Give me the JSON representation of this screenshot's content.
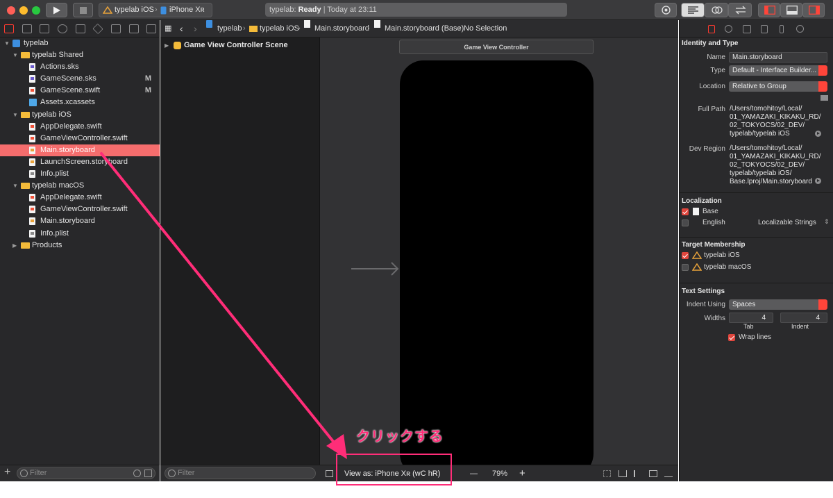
{
  "toolbar": {
    "scheme_target": "typelab iOS",
    "scheme_device": "iPhone Xʀ",
    "status_project": "typelab:",
    "status_state": "Ready",
    "status_time": "Today at 23:11"
  },
  "navigator": {
    "items": [
      {
        "label": "typelab",
        "level": 0,
        "kind": "project",
        "expanded": true,
        "badge": ""
      },
      {
        "label": "typelab Shared",
        "level": 1,
        "kind": "folder",
        "expanded": true,
        "badge": ""
      },
      {
        "label": "Actions.sks",
        "level": 2,
        "kind": "sks",
        "badge": ""
      },
      {
        "label": "GameScene.sks",
        "level": 2,
        "kind": "sks",
        "badge": "M"
      },
      {
        "label": "GameScene.swift",
        "level": 2,
        "kind": "swift",
        "badge": "M"
      },
      {
        "label": "Assets.xcassets",
        "level": 2,
        "kind": "assets",
        "badge": ""
      },
      {
        "label": "typelab iOS",
        "level": 1,
        "kind": "folder",
        "expanded": true,
        "badge": ""
      },
      {
        "label": "AppDelegate.swift",
        "level": 2,
        "kind": "swift",
        "badge": ""
      },
      {
        "label": "GameViewController.swift",
        "level": 2,
        "kind": "swift",
        "badge": ""
      },
      {
        "label": "Main.storyboard",
        "level": 2,
        "kind": "sb",
        "badge": "",
        "selected": true
      },
      {
        "label": "LaunchScreen.storyboard",
        "level": 2,
        "kind": "sb",
        "badge": ""
      },
      {
        "label": "Info.plist",
        "level": 2,
        "kind": "plist",
        "badge": ""
      },
      {
        "label": "typelab macOS",
        "level": 1,
        "kind": "folder",
        "expanded": true,
        "badge": ""
      },
      {
        "label": "AppDelegate.swift",
        "level": 2,
        "kind": "swift",
        "badge": ""
      },
      {
        "label": "GameViewController.swift",
        "level": 2,
        "kind": "swift",
        "badge": ""
      },
      {
        "label": "Main.storyboard",
        "level": 2,
        "kind": "sb",
        "badge": ""
      },
      {
        "label": "Info.plist",
        "level": 2,
        "kind": "plist",
        "badge": ""
      },
      {
        "label": "Products",
        "level": 1,
        "kind": "folder",
        "expanded": false,
        "badge": ""
      }
    ],
    "filter_placeholder": "Filter"
  },
  "jumpbar": {
    "crumbs": [
      "typelab",
      "typelab iOS",
      "Main.storyboard",
      "Main.storyboard (Base)",
      "No Selection"
    ]
  },
  "outline": {
    "scene": "Game View Controller Scene",
    "filter_placeholder": "Filter"
  },
  "canvas": {
    "scene_title": "Game View Controller",
    "view_as": "View as: iPhone Xʀ (wC hR)",
    "zoom": "79%",
    "minus": "—",
    "plus": "+"
  },
  "inspector": {
    "identity_title": "Identity and Type",
    "name_label": "Name",
    "name_value": "Main.storyboard",
    "type_label": "Type",
    "type_value": "Default - Interface Builder...",
    "location_label": "Location",
    "location_value": "Relative to Group",
    "fullpath_label": "Full Path",
    "fullpath_lines": [
      "/Users/tomohitoy/Local/",
      "01_YAMAZAKI_KIKAKU_RD/",
      "02_TOKYOCS/02_DEV/",
      "typelab/typelab iOS"
    ],
    "devregion_label": "Dev Region",
    "devregion_lines": [
      "/Users/tomohitoy/Local/",
      "01_YAMAZAKI_KIKAKU_RD/",
      "02_TOKYOCS/02_DEV/",
      "typelab/typelab iOS/",
      "Base.lproj/Main.storyboard"
    ],
    "localization_title": "Localization",
    "loc_base": "Base",
    "loc_english": "English",
    "loc_english_value": "Localizable Strings",
    "target_title": "Target Membership",
    "target_ios": "typelab iOS",
    "target_macos": "typelab macOS",
    "text_title": "Text Settings",
    "indent_label": "Indent Using",
    "indent_value": "Spaces",
    "widths_label": "Widths",
    "tab_value": "4",
    "indent_width_value": "4",
    "tab_caption": "Tab",
    "indent_caption": "Indent",
    "wrap_label": "Wrap lines"
  },
  "annotation": {
    "text": "クリックする",
    "color": "#ff2d78"
  },
  "colors": {
    "accent": "#ff3b30",
    "selection": "#f56d6d",
    "folder": "#f4bb3a"
  }
}
